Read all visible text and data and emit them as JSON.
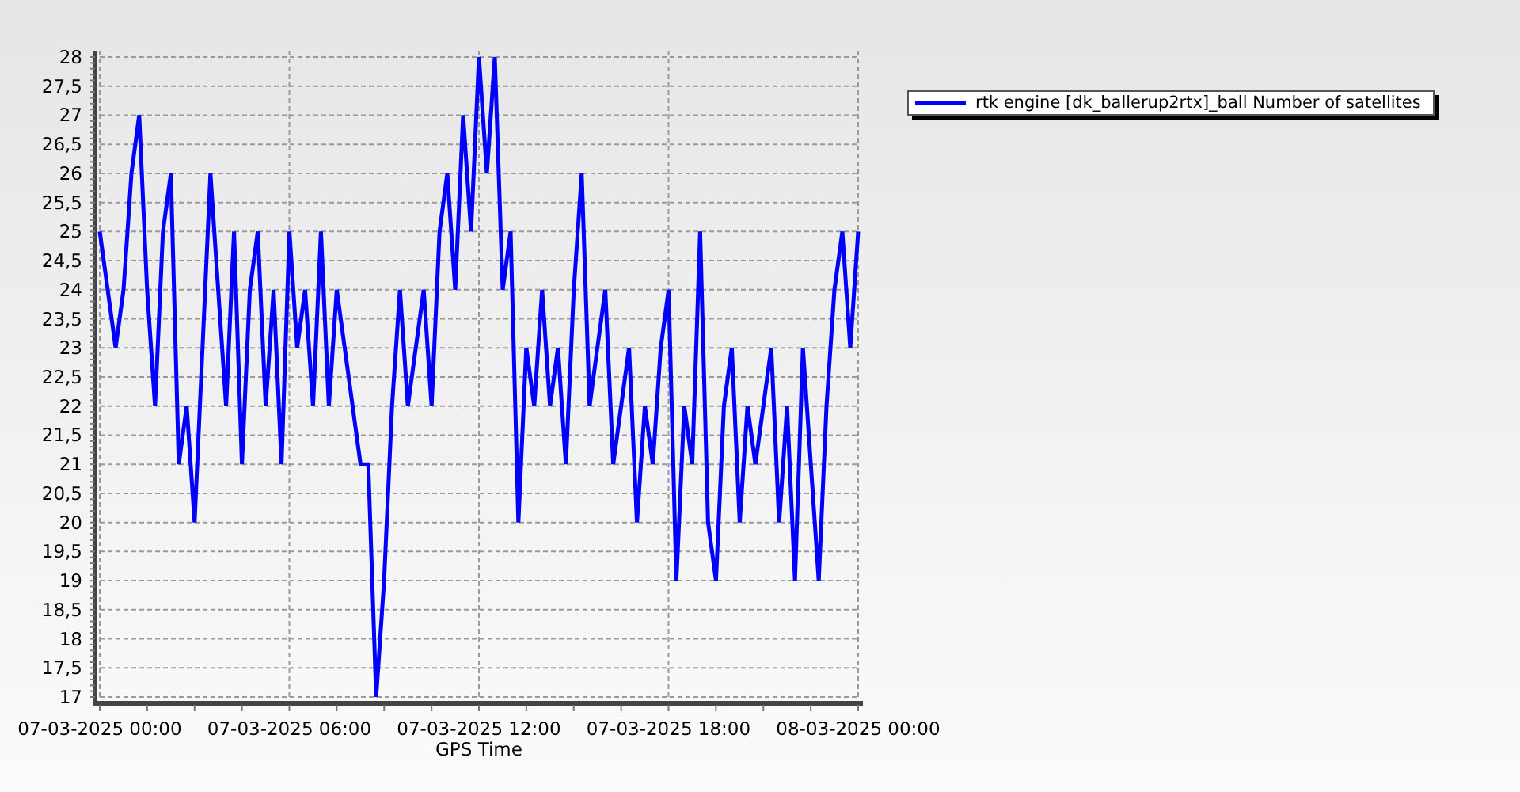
{
  "chart": {
    "chart_data": {
      "type": "line",
      "grid": true,
      "xlabel": "GPS Time",
      "categories": [
        "07-03-2025 00:00",
        null,
        null,
        null,
        null,
        null,
        null,
        null,
        null,
        null,
        null,
        null,
        null,
        null,
        null,
        null,
        null,
        null,
        null,
        null,
        null,
        null,
        null,
        null,
        "07-03-2025 06:00",
        null,
        null,
        null,
        null,
        null,
        null,
        null,
        null,
        null,
        null,
        null,
        null,
        null,
        null,
        null,
        null,
        null,
        null,
        null,
        null,
        null,
        null,
        null,
        "07-03-2025 12:00",
        null,
        null,
        null,
        null,
        null,
        null,
        null,
        null,
        null,
        null,
        null,
        null,
        null,
        null,
        null,
        null,
        null,
        null,
        null,
        null,
        null,
        null,
        null,
        "07-03-2025 18:00",
        null,
        null,
        null,
        null,
        null,
        null,
        null,
        null,
        null,
        null,
        null,
        null,
        null,
        null,
        null,
        null,
        null,
        null,
        null,
        null,
        null,
        null,
        null,
        "08-03-2025 00:00"
      ],
      "series": [
        {
          "name": "rtk engine [dk_ballerup2rtx]_ball Number of satellites",
          "color": "#0000ff",
          "values": [
            25,
            24,
            23,
            24,
            26,
            27,
            24,
            22,
            25,
            26,
            21,
            22,
            20,
            23,
            26,
            24,
            22,
            25,
            21,
            24,
            25,
            22,
            24,
            21,
            25,
            23,
            24,
            22,
            25,
            22,
            24,
            23,
            22,
            21,
            21,
            17,
            19,
            22,
            24,
            22,
            23,
            24,
            22,
            25,
            26,
            24,
            27,
            25,
            28,
            26,
            28,
            24,
            25,
            20,
            23,
            22,
            24,
            22,
            23,
            21,
            24,
            26,
            22,
            23,
            24,
            21,
            22,
            23,
            20,
            22,
            21,
            23,
            24,
            19,
            22,
            21,
            25,
            20,
            19,
            22,
            23,
            20,
            22,
            21,
            22,
            23,
            20,
            22,
            19,
            23,
            21,
            19,
            22,
            24,
            25,
            23,
            25
          ]
        }
      ],
      "ylim": [
        17,
        28
      ],
      "yticks": [
        17,
        {
          "value": 17.5,
          "label": "17,5"
        },
        18,
        {
          "value": 18.5,
          "label": "18,5"
        },
        19,
        {
          "value": 19.5,
          "label": "19,5"
        },
        20,
        {
          "value": 20.5,
          "label": "20,5"
        },
        21,
        {
          "value": 21.5,
          "label": "21,5"
        },
        22,
        {
          "value": 22.5,
          "label": "22,5"
        },
        23,
        {
          "value": 23.5,
          "label": "23,5"
        },
        24,
        {
          "value": 24.5,
          "label": "24,5"
        },
        25,
        {
          "value": 25.5,
          "label": "25,5"
        },
        26,
        {
          "value": 26.5,
          "label": "26,5"
        },
        27,
        {
          "value": 27.5,
          "label": "27,5"
        },
        28
      ]
    }
  }
}
